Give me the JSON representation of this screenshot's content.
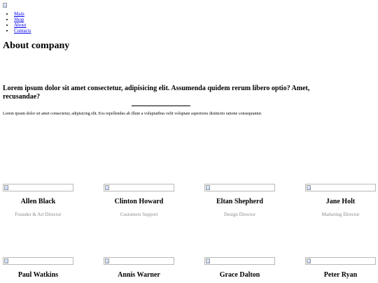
{
  "nav": {
    "items": [
      {
        "label": "Main"
      },
      {
        "label": "Shop"
      },
      {
        "label": "About"
      },
      {
        "label": "Contacts"
      }
    ]
  },
  "page": {
    "title": "About company",
    "headline": "Lorem ipsum dolor sit amet consectetur, adipisicing elit. Assumenda quidem rerum libero optio? Amet, recusandae?",
    "body": "Lorem ipsum dolor sit amet consectetur, adipisicing elit. Eos repellendus ab illum a voluptatibus velit voluptate asperiores distinctio ratione consequuntur."
  },
  "team": [
    {
      "name": "Allen Black",
      "role": "Founder & Art Director"
    },
    {
      "name": "Clinton Howard",
      "role": "Customers Support"
    },
    {
      "name": "Eltan Shepherd",
      "role": "Design Director"
    },
    {
      "name": "Jane Holt",
      "role": "Marketing Director"
    },
    {
      "name": "Paul Watkins",
      "role": ""
    },
    {
      "name": "Annis Warner",
      "role": ""
    },
    {
      "name": "Grace Dalton",
      "role": ""
    },
    {
      "name": "Peter Ryan",
      "role": ""
    }
  ],
  "colors": {
    "link": "#0000ee",
    "role_text": "#8c8c8c"
  }
}
